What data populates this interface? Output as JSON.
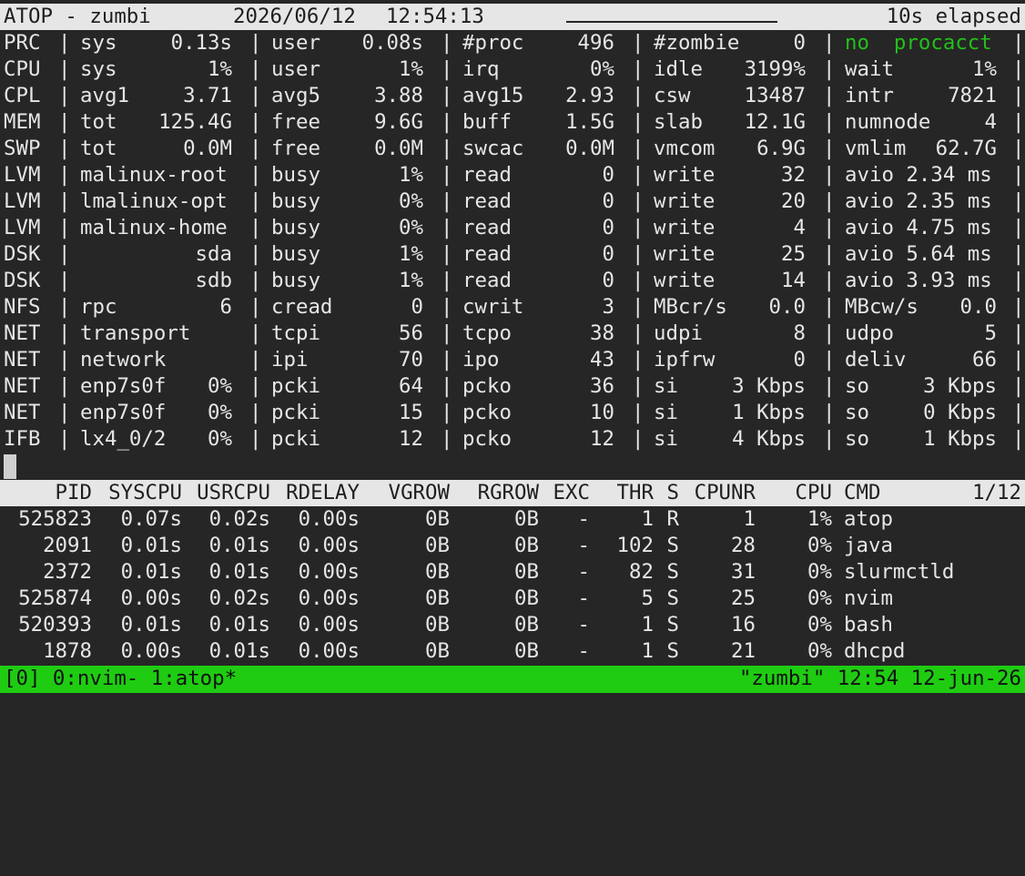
{
  "header": {
    "title": "ATOP - zumbi",
    "date": "2026/06/12",
    "time": "12:54:13",
    "elapsed": "10s elapsed"
  },
  "sys_rows": [
    {
      "label": "PRC",
      "cols": [
        {
          "k": "sys",
          "v": "0.13s"
        },
        {
          "k": "user",
          "v": "0.08s"
        },
        {
          "k": "#proc",
          "v": "496"
        },
        {
          "k": "#zombie",
          "v": "0"
        },
        {
          "k": "no  procacct",
          "v": "",
          "green": true
        }
      ]
    },
    {
      "label": "CPU",
      "cols": [
        {
          "k": "sys",
          "v": "1%"
        },
        {
          "k": "user",
          "v": "1%"
        },
        {
          "k": "irq",
          "v": "0%"
        },
        {
          "k": "idle",
          "v": "3199%"
        },
        {
          "k": "wait",
          "v": "1%"
        }
      ]
    },
    {
      "label": "CPL",
      "cols": [
        {
          "k": "avg1",
          "v": "3.71"
        },
        {
          "k": "avg5",
          "v": "3.88"
        },
        {
          "k": "avg15",
          "v": "2.93"
        },
        {
          "k": "csw",
          "v": "13487"
        },
        {
          "k": "intr",
          "v": "7821"
        }
      ]
    },
    {
      "label": "MEM",
      "cols": [
        {
          "k": "tot",
          "v": "125.4G"
        },
        {
          "k": "free",
          "v": "9.6G"
        },
        {
          "k": "buff",
          "v": "1.5G"
        },
        {
          "k": "slab",
          "v": "12.1G"
        },
        {
          "k": "numnode",
          "v": "4"
        }
      ]
    },
    {
      "label": "SWP",
      "cols": [
        {
          "k": "tot",
          "v": "0.0M"
        },
        {
          "k": "free",
          "v": "0.0M"
        },
        {
          "k": "swcac",
          "v": "0.0M"
        },
        {
          "k": "vmcom",
          "v": "6.9G"
        },
        {
          "k": "vmlim",
          "v": "62.7G"
        }
      ]
    },
    {
      "label": "LVM",
      "cols": [
        {
          "k": "malinux-root",
          "v": ""
        },
        {
          "k": "busy",
          "v": "1%"
        },
        {
          "k": "read",
          "v": "0"
        },
        {
          "k": "write",
          "v": "32"
        },
        {
          "k": "avio 2.34 ms",
          "v": ""
        }
      ]
    },
    {
      "label": "LVM",
      "cols": [
        {
          "k": "lmalinux-opt",
          "v": ""
        },
        {
          "k": "busy",
          "v": "0%"
        },
        {
          "k": "read",
          "v": "0"
        },
        {
          "k": "write",
          "v": "20"
        },
        {
          "k": "avio 2.35 ms",
          "v": ""
        }
      ]
    },
    {
      "label": "LVM",
      "cols": [
        {
          "k": "malinux-home",
          "v": ""
        },
        {
          "k": "busy",
          "v": "0%"
        },
        {
          "k": "read",
          "v": "0"
        },
        {
          "k": "write",
          "v": "4"
        },
        {
          "k": "avio 4.75 ms",
          "v": ""
        }
      ]
    },
    {
      "label": "DSK",
      "cols": [
        {
          "k": "",
          "v": "sda"
        },
        {
          "k": "busy",
          "v": "1%"
        },
        {
          "k": "read",
          "v": "0"
        },
        {
          "k": "write",
          "v": "25"
        },
        {
          "k": "avio 5.64 ms",
          "v": ""
        }
      ]
    },
    {
      "label": "DSK",
      "cols": [
        {
          "k": "",
          "v": "sdb"
        },
        {
          "k": "busy",
          "v": "1%"
        },
        {
          "k": "read",
          "v": "0"
        },
        {
          "k": "write",
          "v": "14"
        },
        {
          "k": "avio 3.93 ms",
          "v": ""
        }
      ]
    },
    {
      "label": "NFS",
      "cols": [
        {
          "k": "rpc",
          "v": "6"
        },
        {
          "k": "cread",
          "v": "0"
        },
        {
          "k": "cwrit",
          "v": "3"
        },
        {
          "k": "MBcr/s",
          "v": "0.0"
        },
        {
          "k": "MBcw/s",
          "v": "0.0"
        }
      ]
    },
    {
      "label": "NET",
      "cols": [
        {
          "k": "transport",
          "v": ""
        },
        {
          "k": "tcpi",
          "v": "56"
        },
        {
          "k": "tcpo",
          "v": "38"
        },
        {
          "k": "udpi",
          "v": "8"
        },
        {
          "k": "udpo",
          "v": "5"
        }
      ]
    },
    {
      "label": "NET",
      "cols": [
        {
          "k": "network",
          "v": ""
        },
        {
          "k": "ipi",
          "v": "70"
        },
        {
          "k": "ipo",
          "v": "43"
        },
        {
          "k": "ipfrw",
          "v": "0"
        },
        {
          "k": "deliv",
          "v": "66"
        }
      ]
    },
    {
      "label": "NET",
      "cols": [
        {
          "k": "enp7s0f",
          "v": "0%"
        },
        {
          "k": "pcki",
          "v": "64"
        },
        {
          "k": "pcko",
          "v": "36"
        },
        {
          "k": "si",
          "v": "3 Kbps"
        },
        {
          "k": "so",
          "v": "3 Kbps"
        }
      ]
    },
    {
      "label": "NET",
      "cols": [
        {
          "k": "enp7s0f",
          "v": "0%"
        },
        {
          "k": "pcki",
          "v": "15"
        },
        {
          "k": "pcko",
          "v": "10"
        },
        {
          "k": "si",
          "v": "1 Kbps"
        },
        {
          "k": "so",
          "v": "0 Kbps"
        }
      ]
    },
    {
      "label": "IFB",
      "cols": [
        {
          "k": "lx4_0/2",
          "v": "0%"
        },
        {
          "k": "pcki",
          "v": "12"
        },
        {
          "k": "pcko",
          "v": "12"
        },
        {
          "k": "si",
          "v": "4 Kbps"
        },
        {
          "k": "so",
          "v": "1 Kbps"
        }
      ]
    }
  ],
  "proc_header": {
    "pid": "PID",
    "syscpu": "SYSCPU",
    "usrcpu": "USRCPU",
    "rdelay": "RDELAY",
    "vgrow": "VGROW",
    "rgrow": "RGROW",
    "exc": "EXC",
    "thr": "THR",
    "s": "S",
    "cpunr": "CPUNR",
    "cpu": "CPU",
    "cmd": "CMD",
    "page": "1/12"
  },
  "processes": [
    {
      "pid": "525823",
      "syscpu": "0.07s",
      "usrcpu": "0.02s",
      "rdelay": "0.00s",
      "vgrow": "0B",
      "rgrow": "0B",
      "exc": "-",
      "thr": "1",
      "s": "R",
      "cpunr": "1",
      "cpu": "1%",
      "cmd": "atop"
    },
    {
      "pid": "2091",
      "syscpu": "0.01s",
      "usrcpu": "0.01s",
      "rdelay": "0.00s",
      "vgrow": "0B",
      "rgrow": "0B",
      "exc": "-",
      "thr": "102",
      "s": "S",
      "cpunr": "28",
      "cpu": "0%",
      "cmd": "java"
    },
    {
      "pid": "2372",
      "syscpu": "0.01s",
      "usrcpu": "0.01s",
      "rdelay": "0.00s",
      "vgrow": "0B",
      "rgrow": "0B",
      "exc": "-",
      "thr": "82",
      "s": "S",
      "cpunr": "31",
      "cpu": "0%",
      "cmd": "slurmctld"
    },
    {
      "pid": "525874",
      "syscpu": "0.00s",
      "usrcpu": "0.02s",
      "rdelay": "0.00s",
      "vgrow": "0B",
      "rgrow": "0B",
      "exc": "-",
      "thr": "5",
      "s": "S",
      "cpunr": "25",
      "cpu": "0%",
      "cmd": "nvim"
    },
    {
      "pid": "520393",
      "syscpu": "0.01s",
      "usrcpu": "0.01s",
      "rdelay": "0.00s",
      "vgrow": "0B",
      "rgrow": "0B",
      "exc": "-",
      "thr": "1",
      "s": "S",
      "cpunr": "16",
      "cpu": "0%",
      "cmd": "bash"
    },
    {
      "pid": "1878",
      "syscpu": "0.00s",
      "usrcpu": "0.01s",
      "rdelay": "0.00s",
      "vgrow": "0B",
      "rgrow": "0B",
      "exc": "-",
      "thr": "1",
      "s": "S",
      "cpunr": "21",
      "cpu": "0%",
      "cmd": "dhcpd"
    }
  ],
  "tmux": {
    "windows": "[0] 0:nvim- 1:atop*",
    "status": "\"zumbi\" 12:54 12-jun-26"
  },
  "colors": {
    "background": "#262626",
    "text": "#e6e6e6",
    "header_bar": "#e6e6e6",
    "accent_green": "#22c01a",
    "tmux_bar": "#1fcc12"
  }
}
